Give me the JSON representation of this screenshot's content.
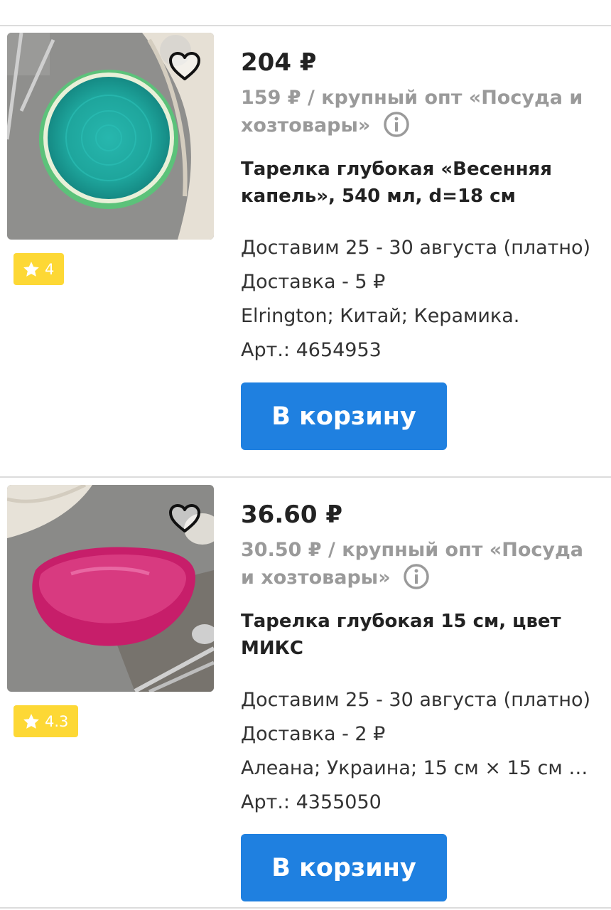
{
  "products": [
    {
      "price": "204 ₽",
      "wholesale": "159 ₽ / крупный опт «Посуда и хозтовары»",
      "title": "Тарелка глубокая «Весенняя капель», 540 мл, d=18 см",
      "rating": "4",
      "delivery_dates": "Доставим 25 - 30 августа (платно)",
      "delivery_cost": "Доставка - 5 ₽",
      "details": "Elrington; Китай; Керамика.",
      "article": "Арт.: 4654953",
      "cart_label": "В корзину",
      "image": "teal-deep-plate-photo"
    },
    {
      "price": "36.60 ₽",
      "wholesale": "30.50 ₽ / крупный опт «Посуда и хозтовары»",
      "title": "Тарелка глубокая 15 см, цвет МИКС",
      "rating": "4.3",
      "delivery_dates": "Доставим 25 - 30 августа (платно)",
      "delivery_cost": "Доставка - 2 ₽",
      "details": "Алеана; Украина; 15 см × 15 см ×...",
      "article": "Арт.: 4355050",
      "cart_label": "В корзину",
      "image": "pink-square-bowl-photo"
    }
  ],
  "icons": {
    "favorite": "heart-outline-icon",
    "rating": "star-icon",
    "info": "info-circle-icon"
  },
  "colors": {
    "button": "#1f80e0",
    "rating_badge": "#fdd835",
    "secondary_text": "#9a9a9a"
  }
}
